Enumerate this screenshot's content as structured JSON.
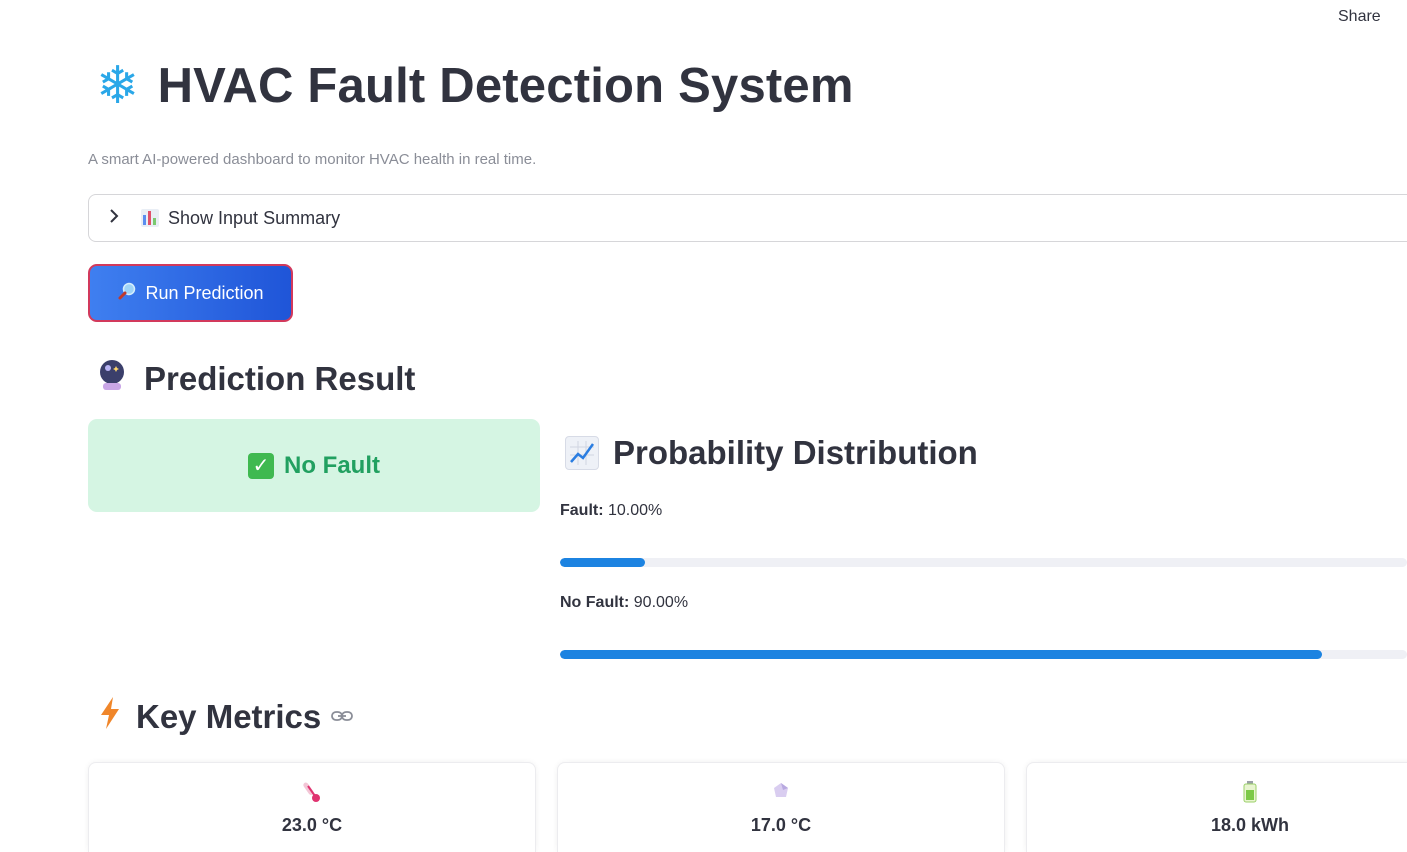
{
  "header": {
    "share_label": "Share"
  },
  "page": {
    "title": "HVAC Fault Detection System",
    "title_icon": "snowflake-icon",
    "subtitle": "A smart AI-powered dashboard to monitor HVAC health in real time."
  },
  "expander": {
    "label": "Show Input Summary",
    "icon": "bar-chart-icon",
    "expanded": false
  },
  "run_button": {
    "label": "Run Prediction",
    "icon": "magnifier-icon"
  },
  "prediction": {
    "heading": "Prediction Result",
    "icon": "crystal-ball-icon",
    "result": "No Fault",
    "result_icon": "check-mark-icon"
  },
  "probability": {
    "heading": "Probability Distribution",
    "icon": "chart-increasing-icon",
    "items": [
      {
        "label": "Fault:",
        "value": "10.00%",
        "fraction": 0.1
      },
      {
        "label": "No Fault:",
        "value": "90.00%",
        "fraction": 0.9
      }
    ]
  },
  "metrics": {
    "heading": "Key Metrics",
    "icon": "lightning-icon",
    "cards": [
      {
        "icon": "thermometer-icon",
        "value": "23.0 °C"
      },
      {
        "icon": "snow-crystal-icon",
        "value": "17.0 °C"
      },
      {
        "icon": "battery-icon",
        "value": "18.0 kWh"
      }
    ]
  },
  "colors": {
    "accent_blue": "#1c83e1",
    "success_bg": "#d5f5e3",
    "success_text": "#21a060",
    "button_gradient_start": "#3f7ff0",
    "button_gradient_end": "#1f55d8",
    "button_border": "#d2395c"
  }
}
